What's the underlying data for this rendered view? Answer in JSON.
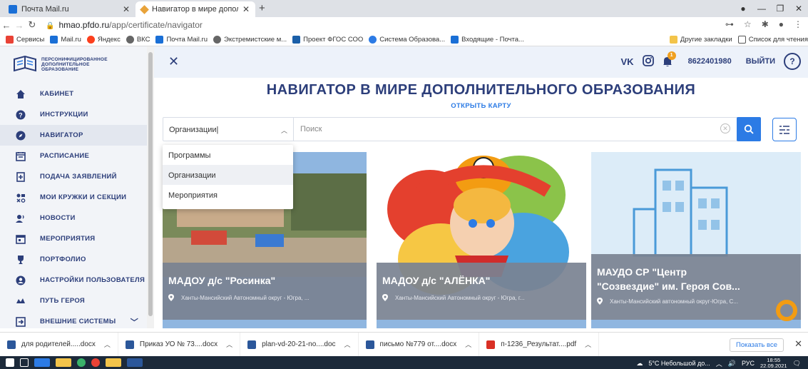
{
  "browser": {
    "tabs": [
      {
        "label": "Почта Mail.ru"
      },
      {
        "label": "Навигатор в мире дополнитель"
      }
    ],
    "url_domain": "hmao.pfdo.ru",
    "url_path": "/app/certificate/navigator",
    "bookmarks": [
      "Сервисы",
      "Mail.ru",
      "Яндекс",
      "ВКС",
      "Почта Mail.ru",
      "Экстремистские м...",
      "Проект ФГОС СОО",
      "Система Образова...",
      "Входящие - Почта..."
    ],
    "bookmarks_right": [
      "Другие закладки",
      "Список для чтения"
    ]
  },
  "sidebar": {
    "logo_text": [
      "ПЕРСОНИФИЦИРОВАННОЕ",
      "ДОПОЛНИТЕЛЬНОЕ",
      "ОБРАЗОВАНИЕ"
    ],
    "items": [
      {
        "label": "КАБИНЕТ",
        "icon": "home-icon"
      },
      {
        "label": "ИНСТРУКЦИИ",
        "icon": "question-icon"
      },
      {
        "label": "НАВИГАТОР",
        "icon": "compass-icon",
        "active": true
      },
      {
        "label": "РАСПИСАНИЕ",
        "icon": "calendar-icon"
      },
      {
        "label": "ПОДАЧА ЗАЯВЛЕНИЙ",
        "icon": "add-doc-icon"
      },
      {
        "label": "МОИ КРУЖКИ И СЕКЦИИ",
        "icon": "activities-icon"
      },
      {
        "label": "НОВОСТИ",
        "icon": "news-icon"
      },
      {
        "label": "МЕРОПРИЯТИЯ",
        "icon": "event-icon"
      },
      {
        "label": "ПОРТФОЛИО",
        "icon": "trophy-icon"
      },
      {
        "label": "НАСТРОЙКИ ПОЛЬЗОВАТЕЛЯ",
        "icon": "user-settings-icon"
      },
      {
        "label": "ПУТЬ ГЕРОЯ",
        "icon": "path-icon"
      },
      {
        "label": "ВНЕШНИЕ СИСТЕМЫ",
        "icon": "external-icon"
      }
    ]
  },
  "header": {
    "vk": "VK",
    "bell_count": "1",
    "account": "8622401980",
    "logout": "ВЫЙТИ",
    "help": "?"
  },
  "main": {
    "title": "НАВИГАТОР В МИРЕ ДОПОЛНИТЕЛЬНОГО ОБРАЗОВАНИЯ",
    "map_link": "ОТКРЫТЬ КАРТУ",
    "search": {
      "category": "Организации",
      "placeholder": "Поиск"
    },
    "dropdown": [
      "Программы",
      "Организации",
      "Мероприятия"
    ],
    "cards": [
      {
        "name": "МАДОУ д/с \"Росинка\"",
        "address": "Ханты-Мансийский Автономный округ - Югра, ..."
      },
      {
        "name": "МАДОУ д/с \"АЛЁНКА\"",
        "address": "Ханты-Мансийский Автономный округ - Югра, г..."
      },
      {
        "name": "МАУДО СР \"Центр",
        "name2": "\"Созвездие\" им. Героя Сов...",
        "address": "Ханты-Мансийский автономный округ-Югра, С..."
      }
    ]
  },
  "downloads": {
    "items": [
      "для родителей.....docx",
      "Приказ УО № 73....docx",
      "plan-vd-20-21-no....doc",
      "письмо №779 от....docx",
      "п-1236_Результат....pdf"
    ],
    "show_all": "Показать все"
  },
  "taskbar": {
    "weather": "5°C Небольшой до...",
    "lang": "РУС",
    "time": "18:55",
    "date": "22.09.2021"
  },
  "colors": {
    "accent": "#2c7be5",
    "navy": "#2c3e7a"
  }
}
